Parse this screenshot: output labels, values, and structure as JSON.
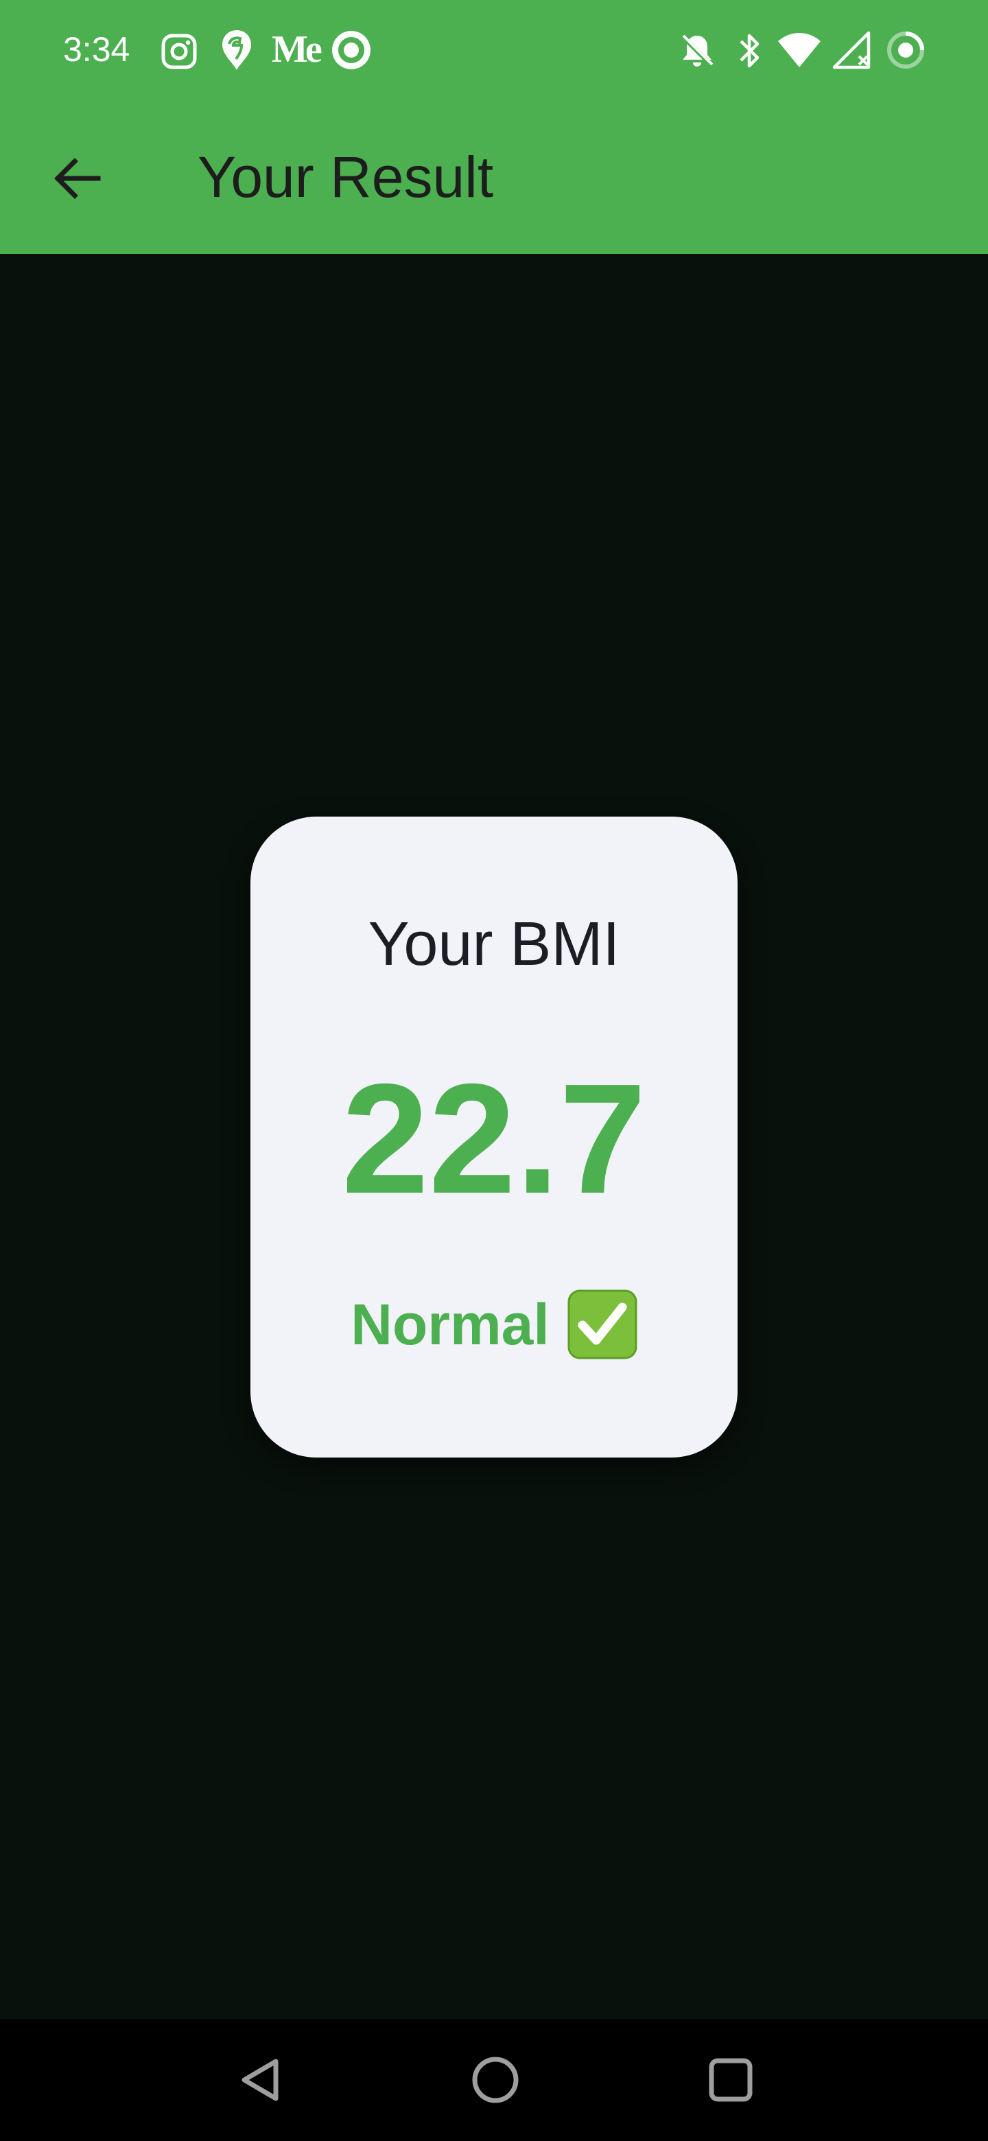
{
  "status_bar": {
    "time": "3:34",
    "notification_icons": [
      "instagram-icon",
      "swiggy-icon",
      "medium-icon",
      "ring-app-icon"
    ],
    "medium_logo_text": "Me",
    "system_icons": [
      "bell-off-icon",
      "bluetooth-icon",
      "wifi-icon",
      "signal-icon",
      "battery-saver-icon"
    ]
  },
  "toolbar": {
    "back_icon": "arrow-left-icon",
    "title": "Your Result",
    "color": "#4caf50"
  },
  "result": {
    "title": "Your BMI",
    "value": "22.7",
    "status": "Normal",
    "status_icon": "check-mark-icon",
    "accent_color": "#4caf50"
  },
  "nav_bar": {
    "buttons": [
      "back-triangle-icon",
      "home-circle-icon",
      "recents-square-icon"
    ]
  }
}
